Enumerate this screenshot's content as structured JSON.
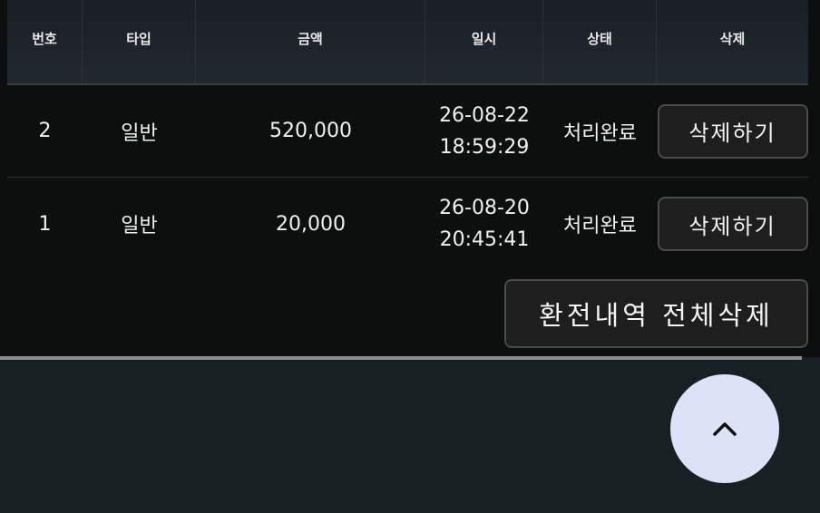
{
  "table": {
    "headers": {
      "no": "번호",
      "type": "타입",
      "amount": "금액",
      "datetime": "일시",
      "status": "상태",
      "delete": "삭제"
    },
    "rows": [
      {
        "no": "2",
        "type": "일반",
        "amount": "520,000",
        "date": "26-08-22",
        "time": "18:59:29",
        "status": "처리완료",
        "delete_label": "삭제하기"
      },
      {
        "no": "1",
        "type": "일반",
        "amount": "20,000",
        "date": "26-08-20",
        "time": "20:45:41",
        "status": "처리완료",
        "delete_label": "삭제하기"
      }
    ]
  },
  "actions": {
    "delete_all_label": "환전내역 전체삭제"
  },
  "scroll_top": {
    "icon": "chevron-up-icon"
  }
}
